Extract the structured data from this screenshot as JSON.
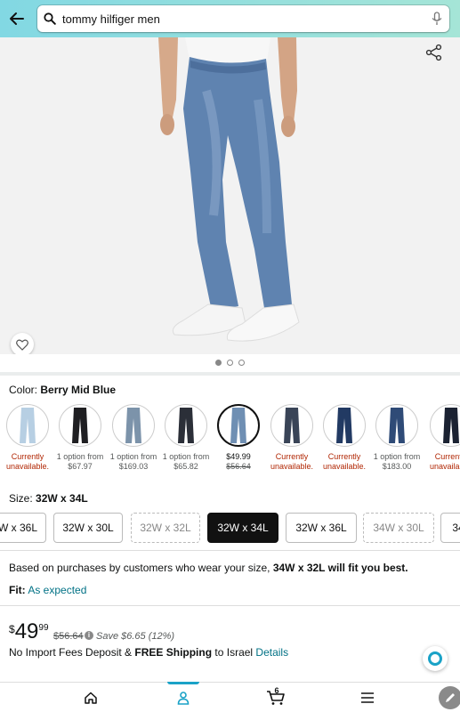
{
  "search": {
    "query": "tommy hilfiger men"
  },
  "gallery": {
    "page_count": 3,
    "current_page": 1
  },
  "color": {
    "label": "Color:",
    "selected": "Berry Mid Blue",
    "options": [
      {
        "line1": "Currently",
        "line2": "unavailable.",
        "state": "unavailable",
        "shade": "#b7cfe3"
      },
      {
        "line1": "1 option from",
        "line2": "$67.97",
        "state": "option",
        "shade": "#1f1f22"
      },
      {
        "line1": "1 option from",
        "line2": "$169.03",
        "state": "option",
        "shade": "#7c93aa"
      },
      {
        "line1": "1 option from",
        "line2": "$65.82",
        "state": "option",
        "shade": "#2b2f38"
      },
      {
        "line1": "$49.99",
        "line2": "$56.64",
        "state": "selected",
        "shade": "#6f8fb3"
      },
      {
        "line1": "Currently",
        "line2": "unavailable.",
        "state": "unavailable",
        "shade": "#394457"
      },
      {
        "line1": "Currently",
        "line2": "unavailable.",
        "state": "unavailable",
        "shade": "#223a63"
      },
      {
        "line1": "1 option from",
        "line2": "$183.00",
        "state": "option",
        "shade": "#2f4b77"
      },
      {
        "line1": "Currently",
        "line2": "unavailable.",
        "state": "unavailable",
        "shade": "#1b2232"
      }
    ]
  },
  "size": {
    "label": "Size:",
    "selected": "32W x 34L",
    "options": [
      {
        "label": "W x 36L",
        "state": "normal"
      },
      {
        "label": "32W x 30L",
        "state": "normal"
      },
      {
        "label": "32W x 32L",
        "state": "disabled"
      },
      {
        "label": "32W x 34L",
        "state": "selected"
      },
      {
        "label": "32W x 36L",
        "state": "normal"
      },
      {
        "label": "34W x 30L",
        "state": "disabled"
      },
      {
        "label": "34",
        "state": "normal"
      }
    ]
  },
  "fit_recommendation": {
    "prefix": "Based on purchases by customers who wear your size, ",
    "highlight": "34W x 32L will fit you best."
  },
  "fit": {
    "label": "Fit:",
    "value": "As expected"
  },
  "price": {
    "currency": "$",
    "whole": "49",
    "fraction": "99",
    "list_price": "$56.64",
    "info": "i",
    "savings": "Save $6.65 (12%)"
  },
  "shipping": {
    "prefix": "No Import Fees Deposit & ",
    "free": "FREE Shipping",
    "middle": " to Israel ",
    "details": "Details"
  },
  "bottom_nav": {
    "cart_count": "6",
    "active": "account"
  },
  "colors": {
    "accent": "#1aa2c7",
    "link": "#007185",
    "unavailable": "#b12704"
  }
}
